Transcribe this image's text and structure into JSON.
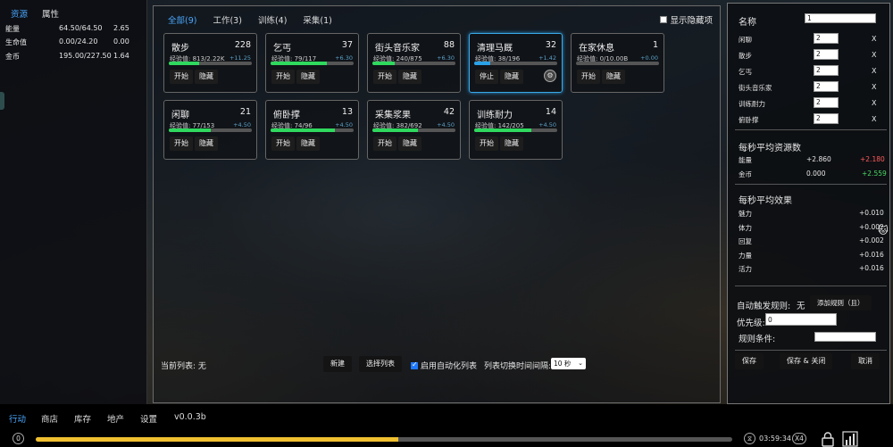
{
  "left_panel": {
    "tabs": [
      "资源",
      "属性"
    ],
    "resources": [
      {
        "name": "能量",
        "value": "64.50/64.50",
        "rate": "2.65"
      },
      {
        "name": "生命值",
        "value": "0.00/24.20",
        "rate": "0.00"
      },
      {
        "name": "金币",
        "value": "195.00/227.50",
        "rate": "1.64"
      }
    ]
  },
  "main": {
    "tabs": [
      "全部(9)",
      "工作(3)",
      "训练(4)",
      "采集(1)"
    ],
    "show_hidden": "显示隐藏项",
    "cards": [
      {
        "name": "散步",
        "count": "228",
        "exp": "经验值: 813/2.22K",
        "rate": "+11.25",
        "progress": 0.37,
        "btn1": "开始",
        "btn2": "隐藏"
      },
      {
        "name": "乞丐",
        "count": "37",
        "exp": "经验值: 79/117",
        "rate": "+6.30",
        "progress": 0.68,
        "btn1": "开始",
        "btn2": "隐藏"
      },
      {
        "name": "街头音乐家",
        "count": "88",
        "exp": "经验值: 240/875",
        "rate": "+6.30",
        "progress": 0.27,
        "btn1": "开始",
        "btn2": "隐藏"
      },
      {
        "name": "清理马厩",
        "count": "32",
        "exp": "经验值: 38/196",
        "rate": "+1.42",
        "progress": 0.19,
        "btn1": "停止",
        "btn2": "隐藏",
        "active": true
      },
      {
        "name": "在家休息",
        "count": "1",
        "exp": "经验值: 0/10.00B",
        "rate": "+0.00",
        "progress": 0.0,
        "btn1": "开始",
        "btn2": "隐藏"
      },
      {
        "name": "闲聊",
        "count": "21",
        "exp": "经验值: 77/153",
        "rate": "+4.50",
        "progress": 0.5,
        "btn1": "开始",
        "btn2": "隐藏"
      },
      {
        "name": "俯卧撑",
        "count": "13",
        "exp": "经验值: 74/96",
        "rate": "+4.50",
        "progress": 0.77,
        "btn1": "开始",
        "btn2": "隐藏"
      },
      {
        "name": "采集浆果",
        "count": "42",
        "exp": "经验值: 382/692",
        "rate": "+4.50",
        "progress": 0.55,
        "btn1": "开始",
        "btn2": "隐藏"
      },
      {
        "name": "训练耐力",
        "count": "14",
        "exp": "经验值: 142/205",
        "rate": "+4.50",
        "progress": 0.69,
        "btn1": "开始",
        "btn2": "隐藏"
      }
    ],
    "current_list": "当前列表: 无",
    "new_btn": "新建",
    "select_list_btn": "选择列表",
    "auto_list": "启用自动化列表",
    "switch_interval_label": "列表切换时间间隔:",
    "switch_interval_value": "10 秒"
  },
  "right_panel": {
    "name_label": "名称",
    "name_value": "1",
    "schedule": [
      {
        "name": "闲聊",
        "value": "2"
      },
      {
        "name": "散步",
        "value": "2"
      },
      {
        "name": "乞丐",
        "value": "2"
      },
      {
        "name": "街头音乐家",
        "value": "2"
      },
      {
        "name": "训练耐力",
        "value": "2"
      },
      {
        "name": "俯卧撑",
        "value": "2"
      }
    ],
    "remove_label": "X",
    "avg_resources_title": "每秒平均资源数",
    "avg_resources": [
      {
        "name": "能量",
        "a": "+2.860",
        "b": "+2.180",
        "b_color": "#ff5b5b"
      },
      {
        "name": "金币",
        "a": "0.000",
        "b": "+2.559",
        "b_color": "#4cd964"
      }
    ],
    "avg_effects_title": "每秒平均效果",
    "avg_effects": [
      {
        "name": "魅力",
        "value": "+0.010"
      },
      {
        "name": "体力",
        "value": "+0.002"
      },
      {
        "name": "回复",
        "value": "+0.002"
      },
      {
        "name": "力量",
        "value": "+0.016"
      },
      {
        "name": "活力",
        "value": "+0.016"
      }
    ],
    "auto_trigger_label": "自动触发规则:",
    "auto_trigger_value": "无",
    "add_rule_btn": "添加规则（且）",
    "priority_label": "优先级:",
    "priority_value": "0",
    "rule_condition_label": "规则条件:",
    "save_btn": "保存",
    "save_close_btn": "保存 & 关闭",
    "cancel_btn": "取消"
  },
  "nav": {
    "items": [
      "行动",
      "商店",
      "库存",
      "地产",
      "设置"
    ],
    "version": "v0.0.3b"
  },
  "status": {
    "left_badge": "0",
    "progress": 0.52,
    "time": "03:59:34",
    "speed": "X4"
  }
}
